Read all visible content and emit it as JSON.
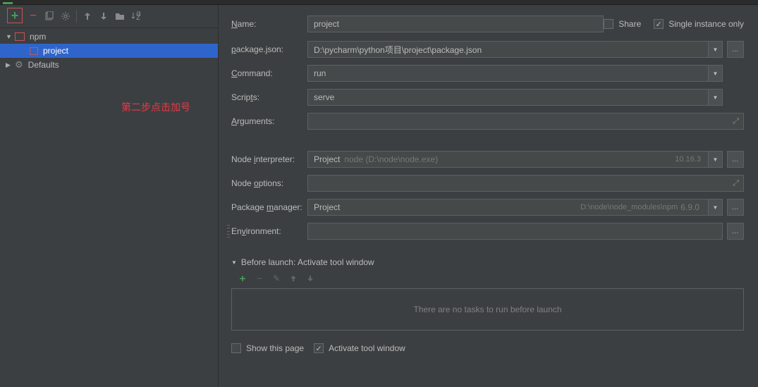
{
  "sidebar": {
    "tree": {
      "npm_label": "npm",
      "project_label": "project",
      "defaults_label": "Defaults"
    },
    "annotation": "第二步点击加号"
  },
  "header": {
    "name_label": "Name:",
    "name_value": "project",
    "share_label": "Share",
    "single_instance_label": "Single instance only"
  },
  "form": {
    "package_json_label": "package.json:",
    "package_json_value": "D:\\pycharm\\python项目\\project\\package.json",
    "command_label": "Command:",
    "command_value": "run",
    "scripts_label": "Scripts:",
    "scripts_value": "serve",
    "arguments_label": "Arguments:",
    "arguments_value": "",
    "node_interpreter_label": "Node interpreter:",
    "node_interpreter_value": "Project",
    "node_interpreter_hint": "node (D:\\node\\node.exe)",
    "node_interpreter_version": "10.16.3",
    "node_options_label": "Node options:",
    "node_options_value": "",
    "package_manager_label": "Package manager:",
    "package_manager_value": "Project",
    "package_manager_hint": "D:\\node\\node_modules\\npm",
    "package_manager_version": "6.9.0",
    "environment_label": "Environment:",
    "environment_value": ""
  },
  "before_launch": {
    "header": "Before launch: Activate tool window",
    "empty_text": "There are no tasks to run before launch",
    "show_page_label": "Show this page",
    "activate_label": "Activate tool window"
  }
}
